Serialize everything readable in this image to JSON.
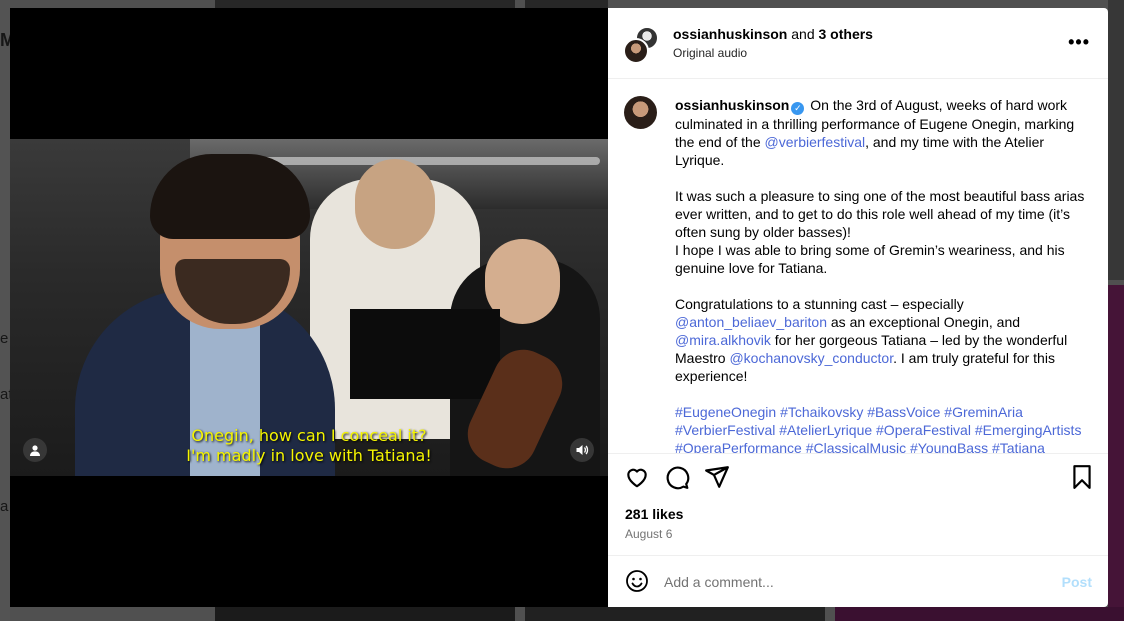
{
  "background": {
    "peek_texts": [
      "M",
      "e",
      "at",
      "a"
    ]
  },
  "video": {
    "subtitle_line1": "Onegin, how can I conceal it?",
    "subtitle_line2": "I'm madly in love with Tatiana!",
    "tag_icon": "user-tag-icon",
    "sound_icon": "speaker-icon"
  },
  "header": {
    "username": "ossianhuskinson",
    "and_text": " and ",
    "others": "3 others",
    "subtitle": "Original audio",
    "more": "•••"
  },
  "caption": {
    "username": "ossianhuskinson",
    "p1_a": " On the 3rd of August, weeks of hard work culminated in a thrilling performance of Eugene Onegin, marking the end of the ",
    "p1_link": "@verbierfestival",
    "p1_b": ", and my time with the Atelier Lyrique.",
    "p2_a": "It was such a pleasure to sing one of the most beautiful bass arias ever written, and to get to do this role well ahead of my time (it’s often sung by older basses)!",
    "p2_b": "I hope I was able to bring some of Gremin’s weariness, and his genuine love for Tatiana.",
    "p3_a": "Congratulations to a stunning cast – especially ",
    "p3_link1": "@anton_beliaev_bariton",
    "p3_b": " as an exceptional Onegin, and ",
    "p3_link2": "@mira.alkhovik",
    "p3_c": " for her gorgeous Tatiana – led by the wonderful Maestro ",
    "p3_link3": "@kochanovsky_conductor",
    "p3_d": ". I am truly grateful for this experience!",
    "hashtags": "#EugeneOnegin #Tchaikovsky #BassVoice #GreminAria #VerbierFestival #AtelierLyrique #OperaFestival #EmergingArtists #OperaPerformance #ClassicalMusic #YoungBass #Tatiana"
  },
  "stats": {
    "likes": "281 likes",
    "date": "August 6"
  },
  "comment": {
    "placeholder": "Add a comment...",
    "post_label": "Post"
  },
  "colors": {
    "link": "#4c68d7",
    "post_disabled": "#b2dffc",
    "verified": "#3897f0"
  }
}
